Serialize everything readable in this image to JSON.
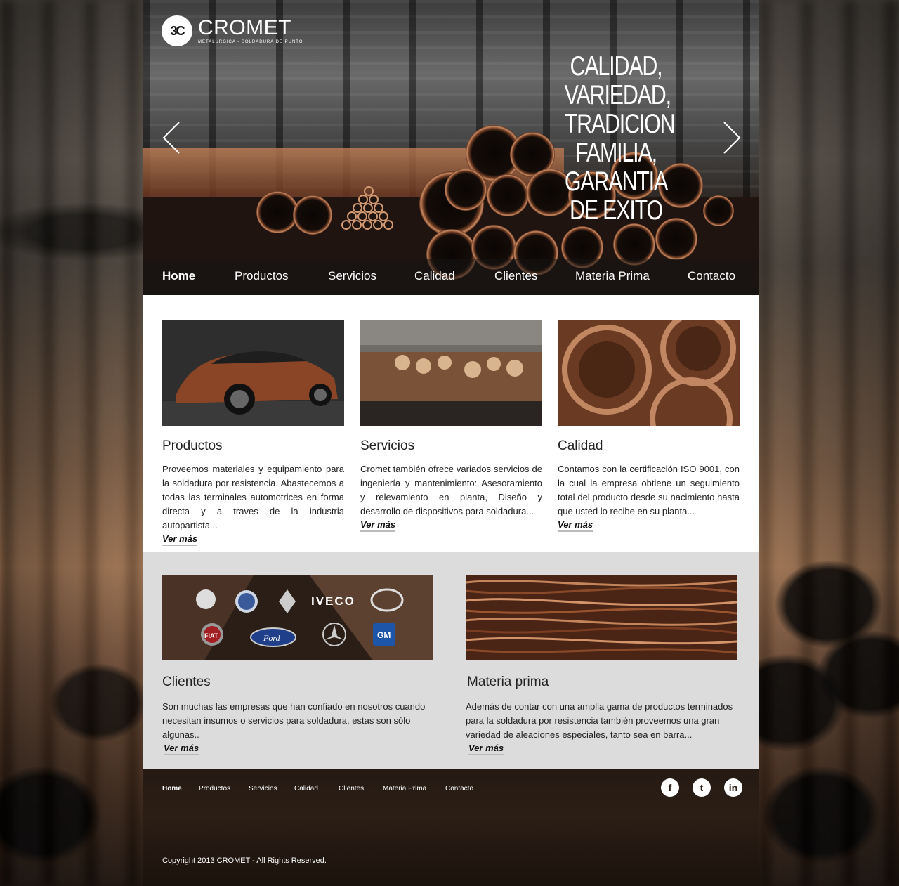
{
  "brand": {
    "name": "CROMET",
    "tagline": "METALURGICA - SOLDADURA DE PUNTO",
    "mark": "3C"
  },
  "hero": {
    "slogan": [
      "CALIDAD,",
      "VARIEDAD,",
      "TRADICION",
      "FAMILIA,",
      "GARANTIA",
      "DE EXITO"
    ]
  },
  "nav": [
    "Home",
    "Productos",
    "Servicios",
    "Calidad",
    "Clientes",
    "Materia Prima",
    "Contacto"
  ],
  "features": [
    {
      "title": "Productos",
      "text": "Proveemos materiales y equipamiento para la soldadura por resistencia. Abastecemos a todas las terminales automotrices en forma directa y a  traves de la industria autopartista...",
      "more": "Ver más"
    },
    {
      "title": "Servicios",
      "text": "Cromet también ofrece variados servicios de ingeniería y mantenimiento: Asesoramiento y relevamiento en planta, Diseño y desarrollo de dispositivos para soldadura...",
      "more": "Ver más"
    },
    {
      "title": "Calidad",
      "text": "Contamos con la certificación ISO 9001, con la cual la empresa obtiene un seguimiento total del producto desde su nacimiento hasta que usted lo recibe en su planta...",
      "more": "Ver más"
    }
  ],
  "clients": {
    "title": "Clientes",
    "text": "Son muchas las empresas que han confiado en nosotros cuando necesitan insumos o servicios para soldadura, estas son sólo algunas..",
    "more": "Ver más",
    "logos": [
      "IVECO",
      "FIAT",
      "Ford",
      "GM"
    ]
  },
  "raw": {
    "title": "Materia prima",
    "text": "Además de contar con una amplia gama de productos terminados para la soldadura por resistencia también proveemos una gran variedad de aleaciones especiales, tanto sea en barra...",
    "more": "Ver más"
  },
  "footer": {
    "nav": [
      "Home",
      "Productos",
      "Servicios",
      "Calidad",
      "Clientes",
      "Materia Prima",
      "Contacto"
    ],
    "social": [
      "f",
      "t",
      "in"
    ],
    "copyright": "Copyright 2013 CROMET - All Rights Reserved."
  },
  "colors": {
    "copper": "#a0603a",
    "footer": "#251a13",
    "band": "#dcdcdc"
  }
}
